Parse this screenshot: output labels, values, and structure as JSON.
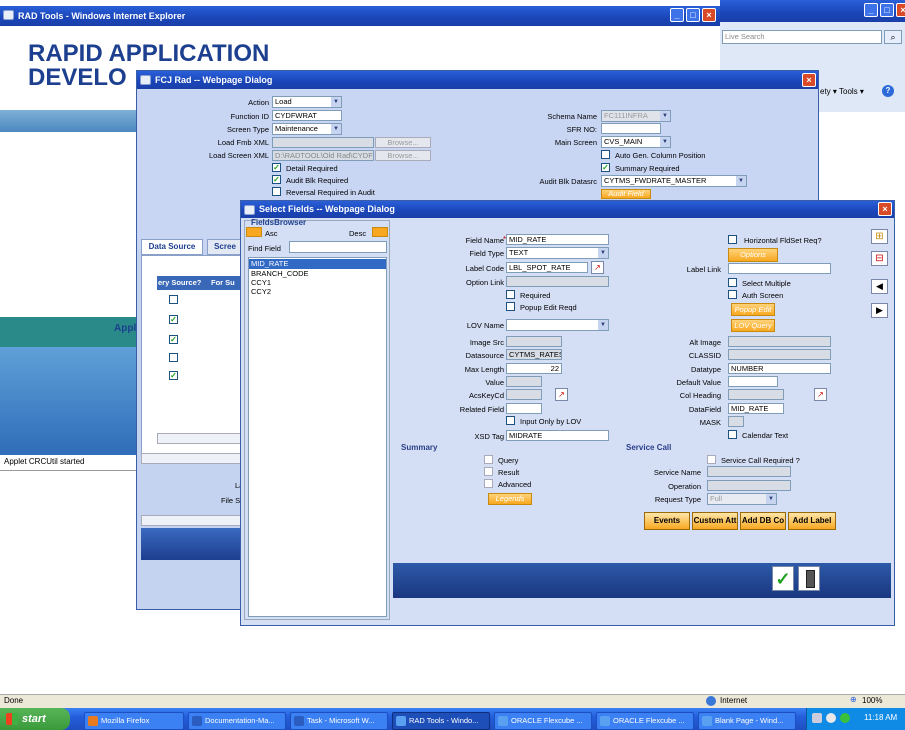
{
  "ie": {
    "title": "RAD Tools - Windows Internet Explorer",
    "search_placeholder": "Live Search",
    "tools_menu": "ety ▾  Tools ▾",
    "status": "Done",
    "zone": "Internet",
    "zoom": "100%"
  },
  "rad": {
    "banner1": "RAPID APPLICATION",
    "banner2": "DEVELO",
    "applet_status": "Applet CRCUtil started",
    "tab1": "Data Source",
    "tab2": "Scree",
    "col1": "ery Source?",
    "col2": "For Su",
    "appl": "Appl",
    "la": "La",
    "filese": "File Se"
  },
  "fcj": {
    "title": "FCJ Rad -- Webpage Dialog",
    "action_label": "Action",
    "action_value": "Load",
    "function_id_label": "Function ID",
    "function_id_value": "CYDFWRAT",
    "screen_type_label": "Screen Type",
    "screen_type_value": "Maintenance",
    "load_fmb_label": "Load Fmb XML",
    "load_screen_label": "Load Screen XML",
    "load_screen_value": "D:\\RADTOOL\\Old Rad\\CYDF",
    "browse": "Browse...",
    "detail_req": "Detail Required",
    "audit_blk": "Audit Blk Required",
    "reversal": "Reversal Required in Audit",
    "schema_label": "Schema Name",
    "schema_value": "FC111INFRA",
    "sfr_label": "SFR NO:",
    "main_screen_label": "Main Screen",
    "main_screen_value": "CVS_MAIN",
    "auto_gen": "Auto Gen. Column Position",
    "summary_req": "Summary Required",
    "audit_ds_label": "Audit Blk Datasrc",
    "audit_ds_value": "CYTMS_FWDRATE_MASTER",
    "audit_field": "Audit Field"
  },
  "sf": {
    "title": "Select Fields -- Webpage Dialog",
    "browser": "FieldsBrowser",
    "asc": "Asc",
    "desc": "Desc",
    "find": "Find Field",
    "fields": [
      "MID_RATE",
      "BRANCH_CODE",
      "CCY1",
      "CCY2"
    ],
    "field_name_label": "Field Name",
    "field_name": "MID_RATE",
    "field_type_label": "Field Type",
    "field_type": "TEXT",
    "label_code_label": "Label Code",
    "label_code": "LBL_SPOT_RATE",
    "option_link": "Option Link",
    "required": "Required",
    "popup_edit": "Popup Edit Reqd",
    "lov_name": "LOV Name",
    "image_src": "Image Src",
    "datasource_label": "Datasource",
    "datasource": "CYTMS_RATES",
    "max_length_label": "Max Length",
    "max_length": "22",
    "value": "Value",
    "acskeycd": "AcsKeyCd",
    "related": "Related Field",
    "input_lov": "Input Only by LOV",
    "xsd_label": "XSD Tag",
    "xsd": "MIDRATE",
    "horiz": "Horizontal FldSet Req?",
    "options": "Options",
    "label_link": "Label Link",
    "select_multi": "Select Multiple",
    "auth_screen": "Auth Screen",
    "popup_edit_btn": "Popup Edit",
    "lov_query": "LOV Query",
    "alt_image": "Alt Image",
    "classid": "CLASSID",
    "datatype_label": "Datatype",
    "datatype": "NUMBER",
    "default_value": "Default Value",
    "col_heading": "Col Heading",
    "datafield_label": "DataField",
    "datafield": "MID_RATE",
    "mask": "MASK",
    "calendar": "Calendar Text",
    "summary": "Summary",
    "query": "Query",
    "result": "Result",
    "advanced": "Advanced",
    "legends": "Legends",
    "service_call": "Service Call",
    "service_req": "Service Call Required ?",
    "service_name": "Service Name",
    "operation": "Operation",
    "request_type_label": "Request Type",
    "request_type": "Full",
    "events": "Events",
    "custom_att": "Custom Att",
    "add_db": "Add DB Co",
    "add_label": "Add Label"
  },
  "taskbar": {
    "start": "start",
    "items": [
      "Mozilla Firefox",
      "Documentation-Ma...",
      "Task - Microsoft W...",
      "RAD Tools - Windo...",
      "ORACLE Flexcube ...",
      "ORACLE Flexcube ...",
      "Blank Page - Wind..."
    ],
    "clock": "11:18 AM"
  }
}
